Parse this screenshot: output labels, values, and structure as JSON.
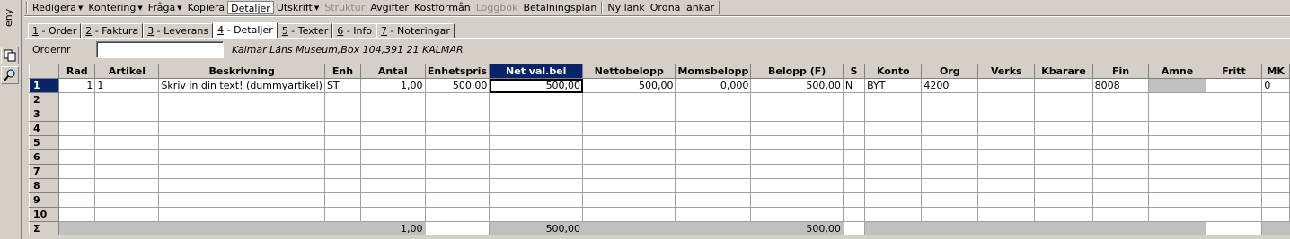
{
  "leftbar": {
    "vertical_label": "eny"
  },
  "menu": {
    "redigera": "Redigera",
    "kontering": "Kontering",
    "fraga": "Fråga",
    "kopiera": "Kopiera",
    "detaljer": "Detaljer",
    "utskrift": "Utskrift",
    "struktur": "Struktur",
    "avgifter": "Avgifter",
    "kostforman": "Kostförmån",
    "loggbok": "Loggbok",
    "betalningsplan": "Betalningsplan",
    "ny_lank": "Ny länk",
    "ordna_lankar": "Ordna länkar"
  },
  "tabs": [
    {
      "num": "1",
      "rest": " - Order"
    },
    {
      "num": "2",
      "rest": " - Faktura"
    },
    {
      "num": "3",
      "rest": " - Leverans"
    },
    {
      "num": "4",
      "rest": " - Detaljer"
    },
    {
      "num": "5",
      "rest": " - Texter"
    },
    {
      "num": "6",
      "rest": " - Info"
    },
    {
      "num": "7",
      "rest": " - Noteringar"
    }
  ],
  "order": {
    "label": "Ordernr",
    "value": "",
    "address": "Kalmar Läns Museum,Box 104,391 21 KALMAR"
  },
  "grid": {
    "headers": [
      "Rad",
      "Artikel",
      "Beskrivning",
      "Enh",
      "Antal",
      "Enhetspris",
      "Net val.bel",
      "Nettobelopp",
      "Momsbelopp",
      "Belopp (F)",
      "S",
      "Konto",
      "Org",
      "Verks",
      "Kbarare",
      "Fin",
      "Amne",
      "Fritt",
      "MK"
    ],
    "row_numbers": [
      "1",
      "2",
      "3",
      "4",
      "5",
      "6",
      "7",
      "8",
      "9",
      "10"
    ],
    "row1": {
      "rad": "1",
      "artikel": "1",
      "beskrivning": "Skriv in din text! (dummyartikel)",
      "enh": "ST",
      "antal": "1,00",
      "enhetspris": "500,00",
      "net_val_bel": "500,00",
      "nettobelopp": "500,00",
      "momsbelopp": "0,000",
      "belopp_f": "500,00",
      "s": "N",
      "konto": "BYT",
      "org": "4200",
      "verks": "",
      "kbarare": "",
      "fin": "8008",
      "amne": "",
      "fritt": "",
      "mk": "0"
    },
    "sum": {
      "symbol": "Σ",
      "antal": "1,00",
      "net_val_bel": "500,00",
      "belopp_f": "500,00"
    }
  }
}
